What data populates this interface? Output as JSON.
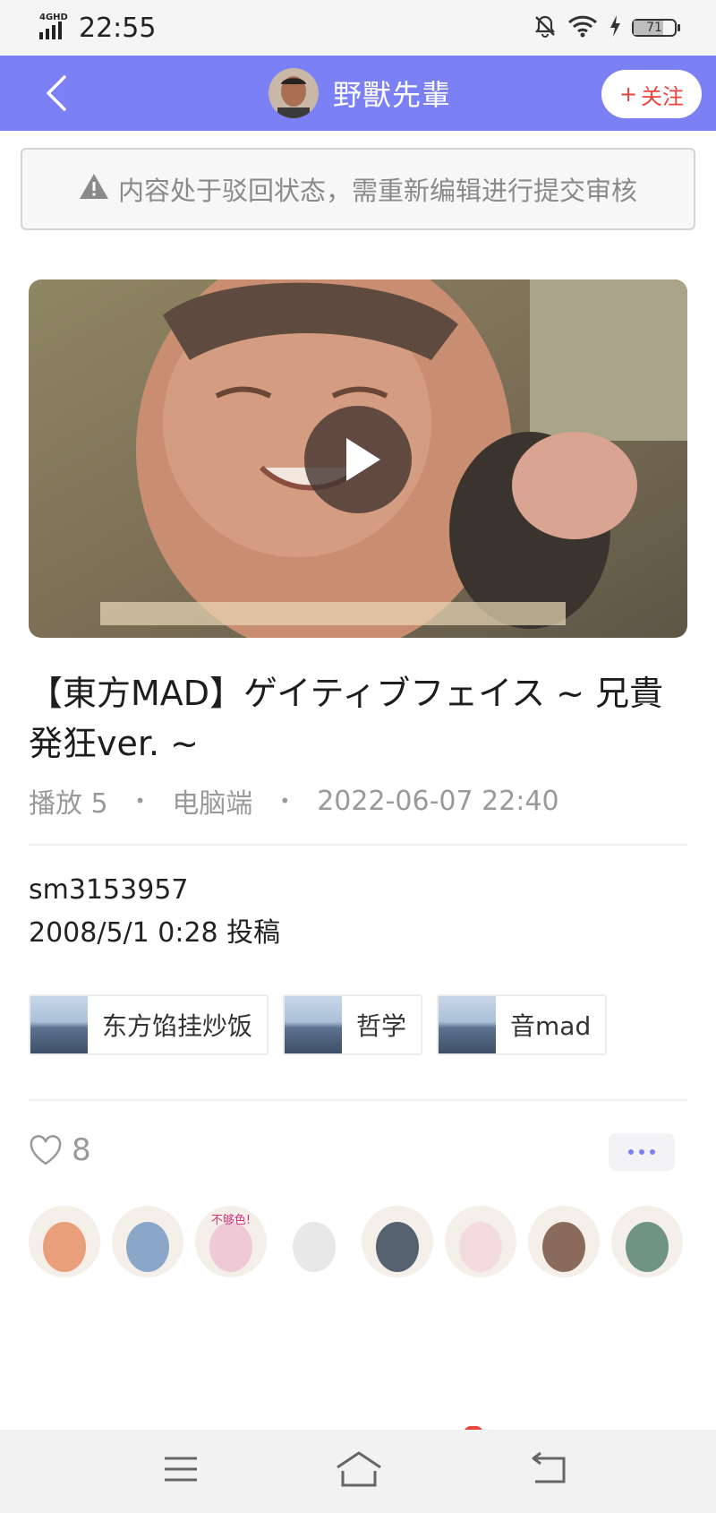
{
  "status_bar": {
    "network": "4GHD",
    "time": "22:55",
    "battery": "71",
    "battery_level": 0.71
  },
  "header": {
    "author_name": "野獸先輩",
    "follow_label": "关注",
    "follow_plus": "+"
  },
  "notice": {
    "text": "内容处于驳回状态，需重新编辑进行提交审核"
  },
  "video": {
    "title": "【東方MAD】ゲイティブフェイス ~ 兄貴発狂ver. ~"
  },
  "meta": {
    "plays": "播放 5",
    "platform": "电脑端",
    "datetime": "2022-06-07 22:40",
    "separator": "•"
  },
  "description": {
    "line1": "sm3153957",
    "line2": "2008/5/1 0:28 投稿"
  },
  "tags": [
    {
      "label": "东方馅挂炒饭"
    },
    {
      "label": "哲学"
    },
    {
      "label": "音mad"
    }
  ],
  "likes": {
    "count": "8"
  },
  "likers": [
    {
      "icon": "anime-girl-orange-avatar",
      "color": "#e9a07a"
    },
    {
      "icon": "anime-headphones-avatar",
      "color": "#8aa7c9"
    },
    {
      "icon": "anime-girl-pink-avatar",
      "color": "#f0c9d6",
      "caption": "不够色!"
    },
    {
      "icon": "sketch-avatar",
      "color": "#e8e8e8"
    },
    {
      "icon": "anime-officer-avatar",
      "color": "#55616e"
    },
    {
      "icon": "doodle-avatar",
      "color": "#f4dcdc"
    },
    {
      "icon": "man-portrait-avatar",
      "color": "#8a6a5a"
    },
    {
      "icon": "green-doodle-avatar",
      "color": "#6f9482"
    }
  ],
  "colors": {
    "header_bg": "#7b80f5",
    "follow_text": "#e8453c",
    "accent": "#7b80f5"
  }
}
